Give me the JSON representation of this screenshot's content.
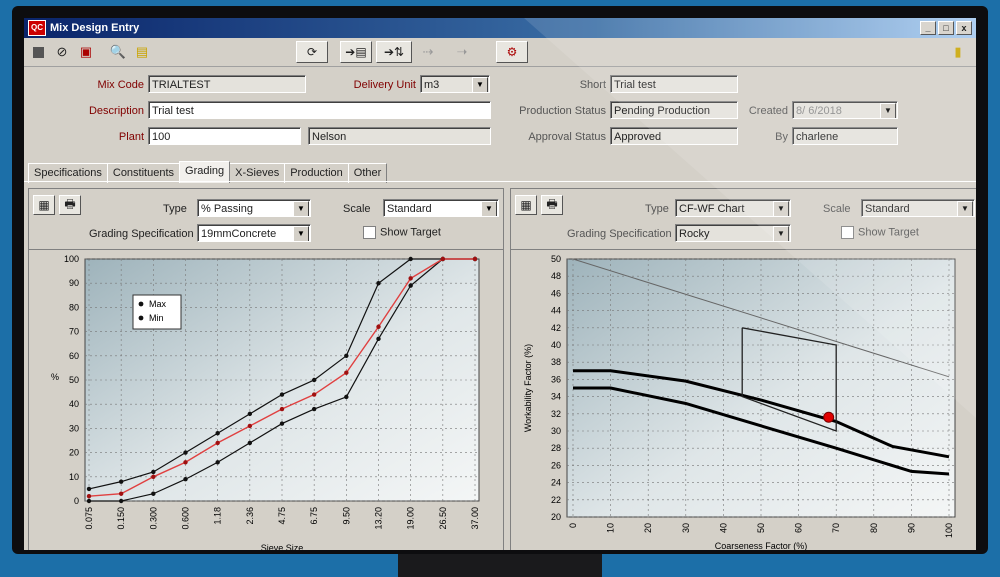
{
  "window": {
    "title": "Mix Design Entry",
    "app_icon": "QC",
    "close_label": "x",
    "min_label": "_",
    "max_label": "□"
  },
  "form": {
    "mix_code_label": "Mix Code",
    "mix_code": "TRIALTEST",
    "description_label": "Description",
    "description": "Trial test",
    "plant_label": "Plant",
    "plant_code": "100",
    "plant_name": "Nelson",
    "delivery_unit_label": "Delivery Unit",
    "delivery_unit": "m3",
    "short_label": "Short",
    "short": "Trial test",
    "production_status_label": "Production Status",
    "production_status": "Pending Production",
    "approval_status_label": "Approval Status",
    "approval_status": "Approved",
    "created_label": "Created",
    "created": "8/ 6/2018",
    "by_label": "By",
    "by": "charlene"
  },
  "tabs": [
    "Specifications",
    "Constituents",
    "Grading",
    "X-Sieves",
    "Production",
    "Other"
  ],
  "active_tab": "Grading",
  "left_panel": {
    "type_label": "Type",
    "type_value": "% Passing",
    "scale_label": "Scale",
    "scale_value": "Standard",
    "spec_label": "Grading Specification",
    "spec_value": "19mmConcrete",
    "show_target_label": "Show Target"
  },
  "right_panel": {
    "type_label": "Type",
    "type_value": "CF-WF Chart",
    "scale_label": "Scale",
    "scale_value": "Standard",
    "spec_label": "Grading Specification",
    "spec_value": "Rocky",
    "show_target_label": "Show Target"
  },
  "colors": {
    "accent": "#cc0000",
    "title_bar": "#0a246a"
  },
  "chart_data": [
    {
      "type": "line",
      "ylabel": "%",
      "xlabel": "Sieve Size",
      "categories": [
        "0.075",
        "0.150",
        "0.300",
        "0.600",
        "1.18",
        "2.36",
        "4.75",
        "6.75",
        "9.50",
        "13.20",
        "19.00",
        "26.50",
        "37.00"
      ],
      "ylim": [
        0,
        100
      ],
      "yticks": [
        "0",
        "10",
        "20",
        "30",
        "40",
        "50",
        "60",
        "70",
        "80",
        "90",
        "100"
      ],
      "legend": [
        "Max",
        "Min"
      ],
      "legend_position": "top-left",
      "series": [
        {
          "name": "Max",
          "values": [
            5,
            8,
            12,
            20,
            28,
            36,
            44,
            50,
            60,
            90,
            100,
            100,
            100
          ]
        },
        {
          "name": "Min",
          "values": [
            0,
            0,
            3,
            9,
            16,
            24,
            32,
            38,
            43,
            67,
            89,
            100,
            100
          ]
        },
        {
          "values": [
            2,
            3,
            10,
            16,
            24,
            31,
            38,
            44,
            53,
            72,
            92,
            100,
            100
          ]
        }
      ]
    },
    {
      "type": "line",
      "ylabel": "Workability Factor (%)",
      "xlabel": "Coarseness Factor (%)",
      "x_ticks": [
        "0",
        "10",
        "20",
        "30",
        "40",
        "50",
        "60",
        "70",
        "80",
        "90",
        "100"
      ],
      "y_ticks": [
        "20",
        "22",
        "24",
        "26",
        "28",
        "30",
        "32",
        "34",
        "36",
        "38",
        "40",
        "42",
        "44",
        "46",
        "48",
        "50"
      ],
      "xlim": [
        0,
        100
      ],
      "ylim": [
        20,
        50
      ],
      "series": [
        {
          "x": [
            0,
            10,
            30,
            50,
            70,
            85,
            100
          ],
          "y": [
            37,
            37,
            35.8,
            33.6,
            31.1,
            28.2,
            27
          ]
        },
        {
          "x": [
            0,
            10,
            30,
            50,
            70,
            90,
            100
          ],
          "y": [
            35,
            35,
            33.2,
            30.6,
            28,
            25.3,
            25
          ]
        },
        {
          "x": [
            0,
            100
          ],
          "y": [
            50,
            36.3
          ]
        },
        {
          "x": [
            45,
            45,
            70,
            70,
            45
          ],
          "y": [
            42,
            34,
            30,
            40,
            42
          ]
        }
      ],
      "point": {
        "x": 68,
        "y": 31.6
      }
    }
  ]
}
